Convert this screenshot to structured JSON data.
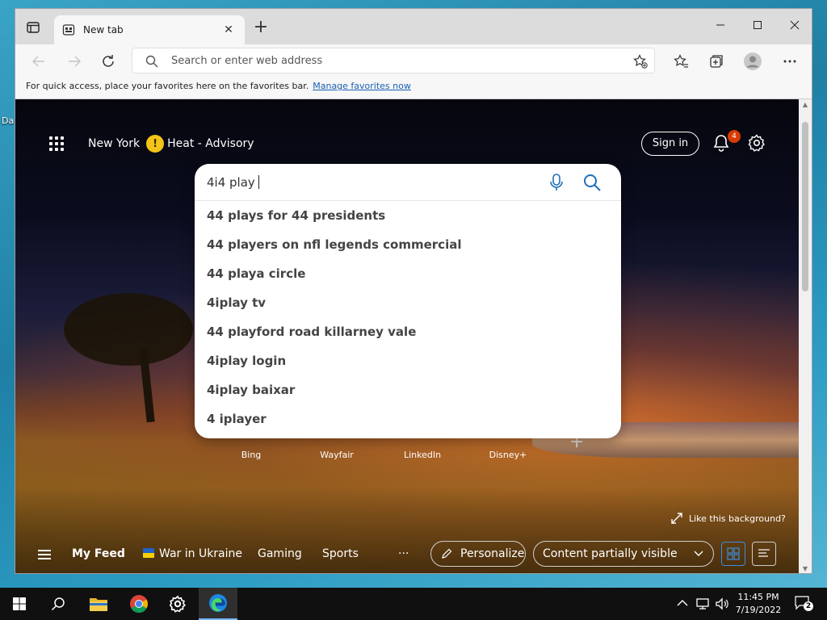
{
  "desktop": {
    "icon_label": "Da"
  },
  "browser": {
    "tab": {
      "title": "New tab"
    },
    "address": {
      "placeholder": "Search or enter web address"
    },
    "favorites_bar": {
      "text": "For quick access, place your favorites here on the favorites bar.",
      "link": "Manage favorites now"
    }
  },
  "newtab": {
    "location": "New York",
    "weather_alert": "Heat - Advisory",
    "sign_in": "Sign in",
    "notification_count": "4",
    "search": {
      "query": "4i4 play",
      "suggestions": [
        "44 plays for 44 presidents",
        "44 players on nfl legends commercial",
        "44 playa circle",
        "4iplay tv",
        "44 playford road killarney vale",
        "4iplay login",
        "4iplay baixar",
        "4 iplayer"
      ]
    },
    "quick_links": [
      {
        "label": "Bing",
        "icon": "bing-icon",
        "color": "#2b6ed9"
      },
      {
        "label": "Wayfair",
        "icon": "wayfair-icon",
        "color": "#c48bd8"
      },
      {
        "label": "LinkedIn",
        "icon": "linkedin-icon",
        "color": "#0a66c2"
      },
      {
        "label": "Disney+",
        "icon": "disney-plus-icon",
        "color": "#113ccf"
      }
    ],
    "background_link": "Like this background?",
    "feed": {
      "items": [
        "My Feed",
        "War in Ukraine",
        "Gaming",
        "Sports"
      ],
      "more": "···",
      "personalize": "Personalize",
      "content_visibility": "Content partially visible"
    }
  },
  "taskbar": {
    "time": "11:45 PM",
    "date": "7/19/2022",
    "notification_count": "2"
  },
  "colors": {
    "accent": "#0078d4",
    "alert_badge": "#d83b01",
    "weather_warning": "#f3c317"
  }
}
